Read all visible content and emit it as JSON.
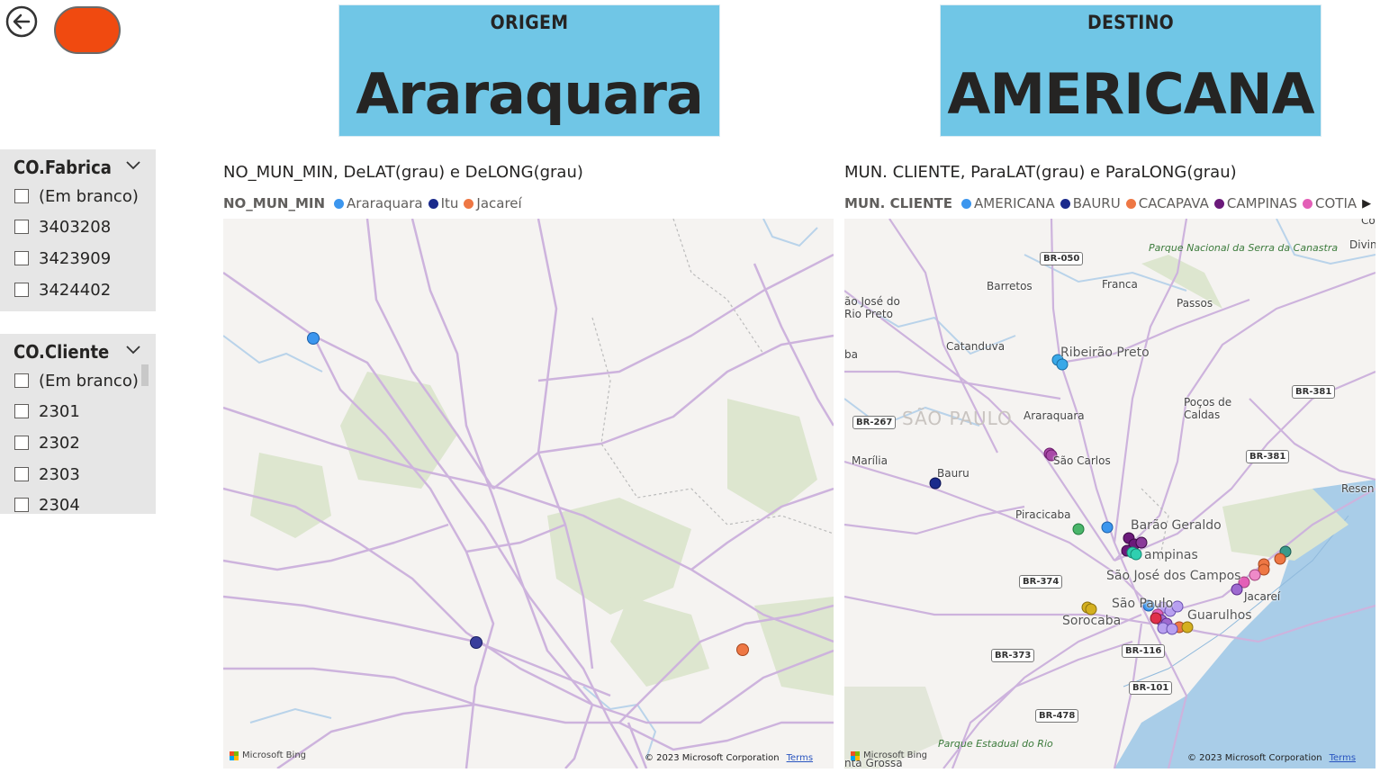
{
  "header": {
    "origem": {
      "label": "ORIGEM",
      "value": "Araraquara"
    },
    "destino": {
      "label": "DESTINO",
      "value": "AMERICANA"
    },
    "accent": "#70c6e6",
    "button_color": "#f04a10"
  },
  "slicers": {
    "fabrica": {
      "title": "CO.Fabrica",
      "items": [
        "(Em branco)",
        "3403208",
        "3423909",
        "3424402"
      ]
    },
    "cliente": {
      "title": "CO.Cliente",
      "items": [
        "(Em branco)",
        "2301",
        "2302",
        "2303",
        "2304"
      ]
    }
  },
  "map_left": {
    "title": "NO_MUN_MIN, DeLAT(grau) e DeLONG(grau)",
    "legend_title": "NO_MUN_MIN",
    "legend": [
      {
        "name": "Araraquara",
        "color": "#3c96ee"
      },
      {
        "name": "Itu",
        "color": "#1a2a8c"
      },
      {
        "name": "Jacareí",
        "color": "#ee7744"
      }
    ],
    "bing": "Microsoft Bing",
    "copyright": "© 2023 Microsoft Corporation",
    "terms": "Terms"
  },
  "map_right": {
    "title": "MUN. CLIENTE, ParaLAT(grau) e ParaLONG(grau)",
    "legend_title": "MUN. CLIENTE",
    "legend": [
      {
        "name": "AMERICANA",
        "color": "#3c96ee"
      },
      {
        "name": "BAURU",
        "color": "#1a2a8c"
      },
      {
        "name": "CACAPAVA",
        "color": "#ee7744"
      },
      {
        "name": "CAMPINAS",
        "color": "#6b1a7a"
      },
      {
        "name": "COTIA",
        "color": "#e35fb7"
      }
    ],
    "towns": {
      "barretos": "Barretos",
      "franca": "Franca",
      "passos": "Passos",
      "sao_jose_rio_preto": "ão José do\nRio Preto",
      "catanduva": "Catanduva",
      "ribeirao": "Ribeirão Preto",
      "pocos": "Poços de\nCaldas",
      "araraquara": "Araraquara",
      "marilia": "Marília",
      "bauru": "Bauru",
      "sao_carlos": "São Carlos",
      "piracicaba": "Piracicaba",
      "barao": "Barão Geraldo",
      "campinas": "ampinas",
      "sjc": "São José dos Campos",
      "sao_paulo_city": "São Paulo",
      "sorocaba": "Sorocaba",
      "guarulhos": "Guarulhos",
      "jacarei": "Jacareí",
      "divin": "Divin",
      "resen": "Resen",
      "ba": "ba",
      "co": "Co",
      "region": "SÃO PAULO",
      "park_canastra": "Parque\nNacional\nda Serra\nda Canastra",
      "park_estadual": "Parque\nEstadual\ndo Rio",
      "pta_grossa": "nta Grossa"
    },
    "shields": [
      "BR-050",
      "BR-267",
      "BR-381",
      "BR-381",
      "BR-374",
      "BR-116",
      "BR-373",
      "BR-101",
      "BR-478"
    ],
    "bing": "Microsoft Bing",
    "copyright": "© 2023 Microsoft Corporation",
    "terms": "Terms"
  }
}
